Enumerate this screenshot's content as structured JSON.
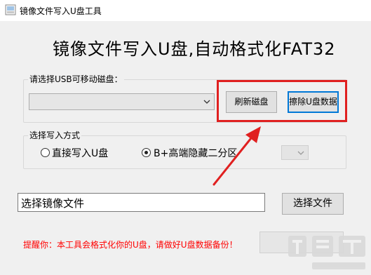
{
  "window": {
    "title": "镜像文件写入U盘工具"
  },
  "headline": "镜像文件写入U盘,自动格式化FAT32",
  "usb_group": {
    "label": "请选择USB可移动磁盘：",
    "selected_value": "",
    "refresh_label": "刷新磁盘",
    "erase_label": "擦除U盘数据"
  },
  "write_mode": {
    "label": "选择写入方式",
    "option_direct": "直接写入U盘",
    "option_hidden": "B+高端隐藏二分区",
    "selected": "B+高端隐藏二分区",
    "partition_select_value": ""
  },
  "image_file": {
    "value": "选择镜像文件",
    "select_label": "选择文件"
  },
  "warning_text": "提醒你：本工具会格式化你的U盘，请做好U盘数据备份！",
  "colors": {
    "highlight": "#e02020",
    "warning": "#ff0000",
    "focus_border": "#0078d7"
  }
}
